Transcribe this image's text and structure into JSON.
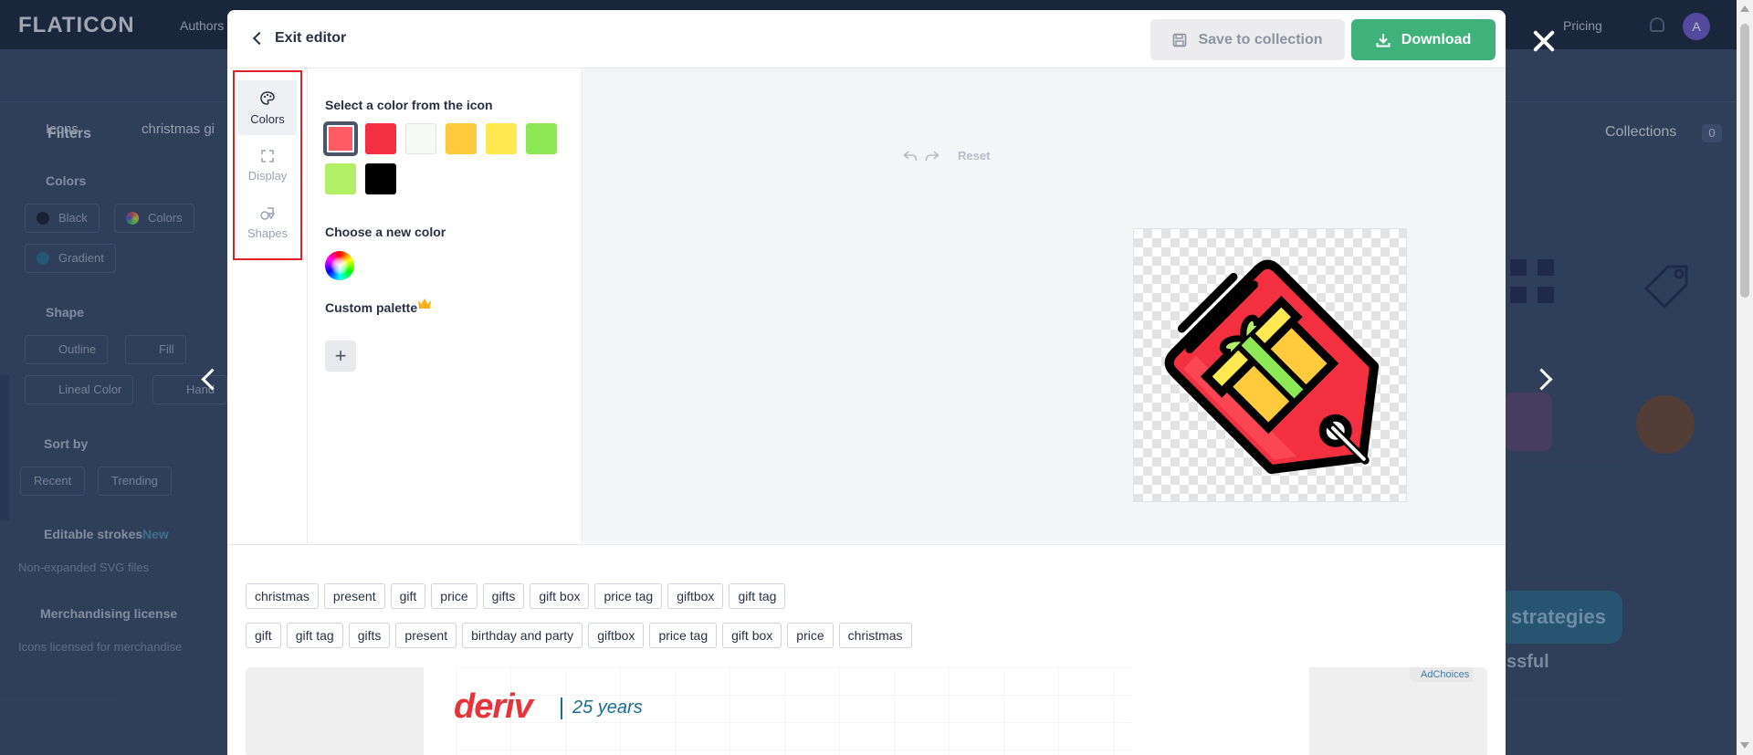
{
  "background": {
    "logo": "FLATICON",
    "nav": {
      "authors": "Authors",
      "pricing": "Pricing"
    },
    "avatar_letter": "A",
    "search": {
      "category": "Icons",
      "query": "christmas gi"
    },
    "collections": {
      "label": "Collections",
      "count": "0"
    },
    "filters_title": "Filters",
    "colors_heading": "Colors",
    "color_chips": [
      "Black",
      "Colors",
      "Gradient"
    ],
    "shape_heading": "Shape",
    "shape_chips": [
      "Outline",
      "Fill",
      "Lineal Color",
      "Hand"
    ],
    "sort_heading": "Sort by",
    "sort_chips": [
      "Recent",
      "Trending"
    ],
    "editable_strokes": "Editable strokes",
    "editable_new": "New",
    "editable_note": "Non-expanded SVG files",
    "merch_heading": "Merchandising license",
    "merch_note": "Icons licensed for merchandise",
    "ad_text_1": "strategies",
    "ad_text_2": "ssful"
  },
  "modal": {
    "exit_label": "Exit editor",
    "save_label": "Save to collection",
    "download_label": "Download",
    "tools": [
      {
        "label": "Colors",
        "icon": "palette-icon",
        "active": true
      },
      {
        "label": "Display",
        "icon": "expand-icon",
        "active": false
      },
      {
        "label": "Shapes",
        "icon": "shapes-icon",
        "active": false
      }
    ],
    "panel": {
      "select_color_label": "Select a color from the icon",
      "swatches": [
        "#ff5b65",
        "#f3303f",
        "#f7fbf5",
        "#ffcb3d",
        "#ffe850",
        "#8ce854",
        "#b4f067",
        "#000000"
      ],
      "selected_swatch": 0,
      "new_color_label": "Choose a new color",
      "custom_palette_label": "Custom palette",
      "add_symbol": "+"
    },
    "canvas": {
      "reset_label": "Reset"
    },
    "tags_row_1": [
      "christmas",
      "present",
      "gift",
      "price",
      "gifts",
      "gift box",
      "price tag",
      "giftbox",
      "gift tag"
    ],
    "tags_row_2": [
      "gift",
      "gift tag",
      "gifts",
      "present",
      "birthday and party",
      "giftbox",
      "price tag",
      "gift box",
      "price",
      "christmas"
    ],
    "ad": {
      "brand": "deriv",
      "years": "25 years",
      "adchoices": "AdChoices"
    }
  },
  "colors": {
    "accent_green": "#3eb27a",
    "highlight_red": "#e0202a",
    "tag_red": "#f3303f",
    "tag_yellow": "#ffcb3d",
    "tag_light_green": "#8ce854"
  }
}
